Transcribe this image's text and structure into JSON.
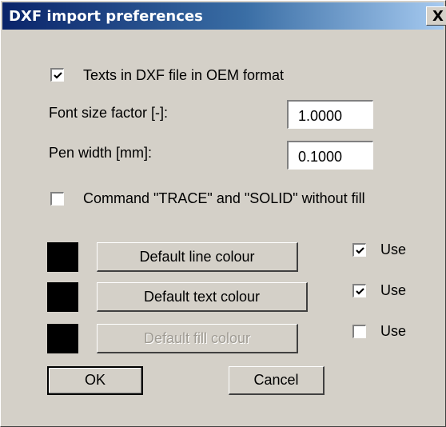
{
  "dialog": {
    "title": "DXF import preferences",
    "close_glyph": "X"
  },
  "options": {
    "oem_texts": {
      "label": "Texts in DXF file in OEM format",
      "checked": true
    },
    "font_size_factor": {
      "label": "Font size factor [-]:",
      "value": "1.0000"
    },
    "pen_width": {
      "label": "Pen width [mm]:",
      "value": "0.1000"
    },
    "trace_solid": {
      "label": "Command \"TRACE\" and \"SOLID\" without fill",
      "checked": false
    }
  },
  "colours": [
    {
      "button": "Default line colour",
      "swatch": "#000000",
      "use_label": "Use",
      "use_checked": true,
      "enabled": true
    },
    {
      "button": "Default text colour",
      "swatch": "#000000",
      "use_label": "Use",
      "use_checked": true,
      "enabled": true
    },
    {
      "button": "Default fill colour",
      "swatch": "#000000",
      "use_label": "Use",
      "use_checked": false,
      "enabled": false
    }
  ],
  "buttons": {
    "ok": "OK",
    "cancel": "Cancel"
  },
  "theme": {
    "face": "#d4d0c8",
    "title_start": "#0a246a",
    "title_end": "#a6caf0",
    "disabled_text": "#9e9a92"
  }
}
